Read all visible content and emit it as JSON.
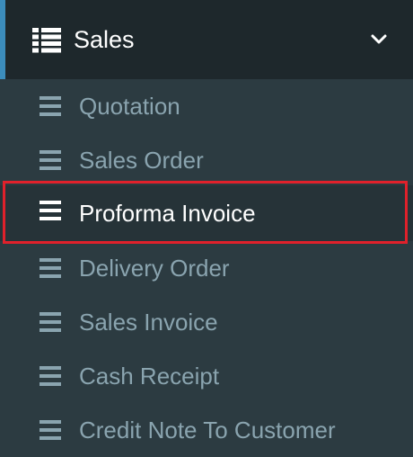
{
  "header": {
    "label": "Sales",
    "icon": "list-icon",
    "chevron_icon": "chevron-down-icon"
  },
  "items": [
    {
      "label": "Quotation"
    },
    {
      "label": "Sales Order"
    },
    {
      "label": "Proforma Invoice",
      "active": true
    },
    {
      "label": "Delivery Order"
    },
    {
      "label": "Sales Invoice"
    },
    {
      "label": "Cash Receipt"
    },
    {
      "label": "Credit Note To Customer"
    }
  ],
  "colors": {
    "header_bg": "#1e282c",
    "menu_bg": "#2c3b41",
    "accent": "#3c8dbc",
    "item_text": "#8aa4af",
    "active_text": "#ffffff",
    "highlight_border": "#e0212b"
  }
}
